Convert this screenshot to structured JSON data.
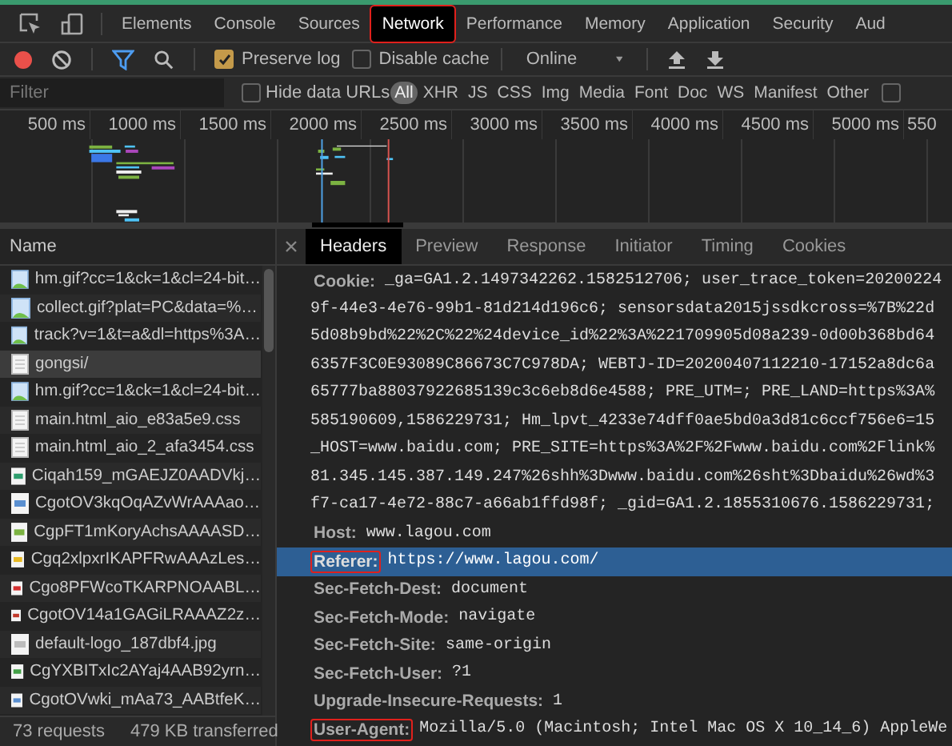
{
  "panel_tabs": [
    {
      "label": "Elements",
      "selected": false,
      "highlighted": false
    },
    {
      "label": "Console",
      "selected": false,
      "highlighted": false
    },
    {
      "label": "Sources",
      "selected": false,
      "highlighted": false
    },
    {
      "label": "Network",
      "selected": true,
      "highlighted": true
    },
    {
      "label": "Performance",
      "selected": false,
      "highlighted": false
    },
    {
      "label": "Memory",
      "selected": false,
      "highlighted": false
    },
    {
      "label": "Application",
      "selected": false,
      "highlighted": false
    },
    {
      "label": "Security",
      "selected": false,
      "highlighted": false
    },
    {
      "label": "Aud",
      "selected": false,
      "highlighted": false
    }
  ],
  "toolbar": {
    "recording": true,
    "filter_active": true,
    "preserve_log": {
      "label": "Preserve log",
      "checked": true
    },
    "disable_cache": {
      "label": "Disable cache",
      "checked": false
    },
    "throttling": "Online"
  },
  "filter_bar": {
    "placeholder": "Filter",
    "hide_data_urls": {
      "label": "Hide data URLs",
      "checked": false
    },
    "types": [
      {
        "label": "All",
        "selected": true
      },
      {
        "label": "XHR",
        "selected": false
      },
      {
        "label": "JS",
        "selected": false
      },
      {
        "label": "CSS",
        "selected": false
      },
      {
        "label": "Img",
        "selected": false
      },
      {
        "label": "Media",
        "selected": false
      },
      {
        "label": "Font",
        "selected": false
      },
      {
        "label": "Doc",
        "selected": false
      },
      {
        "label": "WS",
        "selected": false
      },
      {
        "label": "Manifest",
        "selected": false
      },
      {
        "label": "Other",
        "selected": false
      }
    ],
    "extra_checkbox": {
      "checked": false
    }
  },
  "timeline": {
    "ticks": [
      "500 ms",
      "1000 ms",
      "1500 ms",
      "2000 ms",
      "2500 ms",
      "3000 ms",
      "3500 ms",
      "4000 ms",
      "4500 ms",
      "5000 ms",
      "550"
    ]
  },
  "requests": {
    "column": "Name",
    "rows": [
      {
        "name": "hm.gif?cc=1&ck=1&cl=24-bit…",
        "kind": "image",
        "selected": false
      },
      {
        "name": "collect.gif?plat=PC&data=%…",
        "kind": "image",
        "selected": false
      },
      {
        "name": "track?v=1&t=a&dl=https%3A…",
        "kind": "image",
        "selected": false
      },
      {
        "name": "gongsi/",
        "kind": "document",
        "selected": true
      },
      {
        "name": "hm.gif?cc=1&ck=1&cl=24-bit…",
        "kind": "image",
        "selected": false
      },
      {
        "name": "main.html_aio_e83a5e9.css",
        "kind": "document",
        "selected": false
      },
      {
        "name": "main.html_aio_2_afa3454.css",
        "kind": "document",
        "selected": false
      },
      {
        "name": "Ciqah159_mGAEJZ0AADVkj…",
        "kind": "thumbnail",
        "color": "#2e9e6e",
        "selected": false
      },
      {
        "name": "CgotOV3kqOqAZvWrAAAao…",
        "kind": "thumbnail",
        "color": "#5a8fd0",
        "selected": false
      },
      {
        "name": "CgpFT1mKoryAchsAAAASD…",
        "kind": "thumbnail",
        "color": "#7cb342",
        "selected": false
      },
      {
        "name": "Cgq2xlpxrIKAPFRwAAAzLes…",
        "kind": "thumbnail",
        "color": "#e8b923",
        "selected": false
      },
      {
        "name": "Cgo8PFWcoTKARPNOAABL…",
        "kind": "thumbnail",
        "color": "#d32f2f",
        "selected": false
      },
      {
        "name": "CgotOV14a1GAGiLRAAAZ2z…",
        "kind": "thumbnail",
        "color": "#c0392b",
        "selected": false
      },
      {
        "name": "default-logo_187dbf4.jpg",
        "kind": "thumbnail",
        "color": "#bdbdbd",
        "selected": false
      },
      {
        "name": "CgYXBITxIc2AYaj4AAB92yrn…",
        "kind": "thumbnail",
        "color": "#43a047",
        "selected": false
      },
      {
        "name": "CgotOVwki_mAa73_AABtfeK…",
        "kind": "thumbnail",
        "color": "#5a8fd0",
        "selected": false
      }
    ]
  },
  "status_bar": {
    "requests": "73 requests",
    "transferred": "479 KB transferred"
  },
  "detail_tabs": [
    {
      "label": "Headers",
      "selected": true
    },
    {
      "label": "Preview",
      "selected": false
    },
    {
      "label": "Response",
      "selected": false
    },
    {
      "label": "Initiator",
      "selected": false
    },
    {
      "label": "Timing",
      "selected": false
    },
    {
      "label": "Cookies",
      "selected": false
    }
  ],
  "header_lines": [
    {
      "key": "Cookie:",
      "value": "_ga=GA1.2.1497342262.1582512706; user_trace_token=20200224",
      "selected": false,
      "highlighted": false
    },
    {
      "value": "9f-44e3-4e76-99b1-81d214d196c6; sensorsdata2015jssdkcross=%7B%22d",
      "selected": false
    },
    {
      "value": "5d08b9bd%22%2C%22%24device_id%22%3A%221709905d08a239-0d00b368bd64",
      "selected": false
    },
    {
      "value": "6357F3C0E93089C86673C7C978DA; WEBTJ-ID=20200407112210-17152a8dc6a",
      "selected": false
    },
    {
      "value": "65777ba88037922685139c3c6eb8d6e4588; PRE_UTM=; PRE_LAND=https%3A%",
      "selected": false
    },
    {
      "value": "585190609,1586229731; Hm_lpvt_4233e74dff0ae5bd0a3d81c6ccf756e6=15",
      "selected": false
    },
    {
      "value": "_HOST=www.baidu.com; PRE_SITE=https%3A%2F%2Fwww.baidu.com%2Flink%",
      "selected": false
    },
    {
      "value": "81.345.145.387.149.247%26shh%3Dwww.baidu.com%26sht%3Dbaidu%26wd%3",
      "selected": false
    },
    {
      "value": "f7-ca17-4e72-88c7-a66ab1ffd98f; _gid=GA1.2.1855310676.1586229731;",
      "selected": false
    },
    {
      "key": "Host:",
      "value": "www.lagou.com",
      "selected": false,
      "highlighted": false
    },
    {
      "key": "Referer:",
      "value": "https://www.lagou.com/",
      "selected": true,
      "highlighted": true
    },
    {
      "key": "Sec-Fetch-Dest:",
      "value": "document",
      "selected": false,
      "highlighted": false
    },
    {
      "key": "Sec-Fetch-Mode:",
      "value": "navigate",
      "selected": false,
      "highlighted": false
    },
    {
      "key": "Sec-Fetch-Site:",
      "value": "same-origin",
      "selected": false,
      "highlighted": false
    },
    {
      "key": "Sec-Fetch-User:",
      "value": "?1",
      "selected": false,
      "highlighted": false
    },
    {
      "key": "Upgrade-Insecure-Requests:",
      "value": "1",
      "selected": false,
      "highlighted": false
    },
    {
      "key": "User-Agent:",
      "value": "Mozilla/5.0 (Macintosh; Intel Mac OS X 10_14_6) AppleWe",
      "selected": false,
      "highlighted": true
    }
  ]
}
